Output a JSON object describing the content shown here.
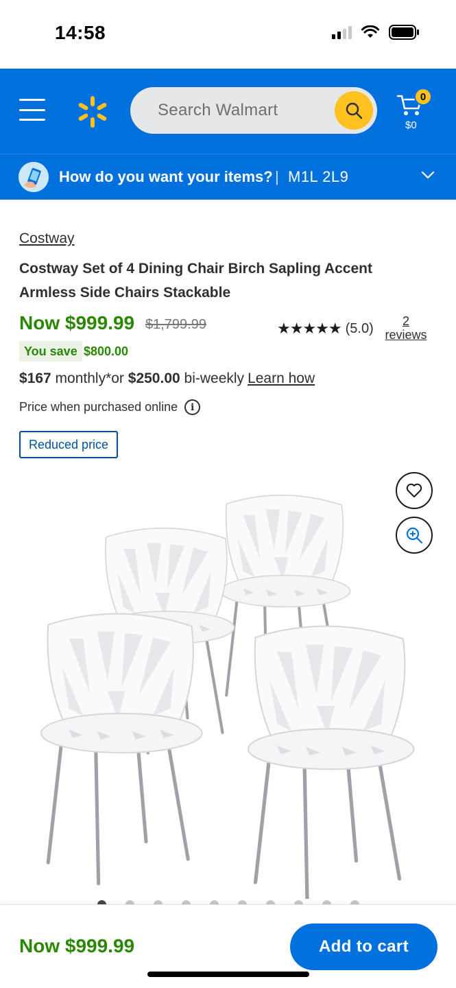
{
  "status_bar": {
    "time": "14:58"
  },
  "header": {
    "search_placeholder": "Search Walmart",
    "cart_count": "0",
    "cart_total": "$0",
    "brand_color": "#0071dc",
    "accent_color": "#ffc220"
  },
  "delivery": {
    "question": "How do you want your items?",
    "separator": "|",
    "postal_code": "M1L 2L9"
  },
  "product": {
    "brand": "Costway",
    "title": "Costway Set of 4 Dining Chair Birch Sapling Accent Armless Side Chairs Stackable",
    "price_now": "Now $999.99",
    "price_was": "$1,799.99",
    "rating_stars": "★★★★★",
    "rating_value": "(5.0)",
    "reviews_count": "2",
    "reviews_label": "reviews",
    "you_save_label": "You save",
    "save_amount": "$800.00",
    "monthly_amount": "$167",
    "monthly_text": " monthly*or ",
    "biweekly_amount": "$250.00",
    "biweekly_text": " bi-weekly",
    "learn_how": "Learn how",
    "online_note": "Price when purchased online",
    "info_glyph": "i",
    "badge": "Reduced price",
    "image_count": 10,
    "active_image_index": 0
  },
  "bottom_bar": {
    "price": "Now $999.99",
    "add_to_cart": "Add to cart"
  }
}
